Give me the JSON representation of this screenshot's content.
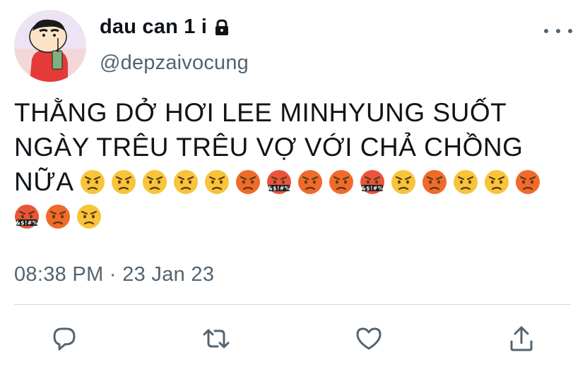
{
  "user": {
    "display_name": "dau can 1 i",
    "handle": "@depzaivocung",
    "lock_icon": "lock-icon",
    "avatar": "profile-avatar"
  },
  "tweet": {
    "text": "THẰNG DỞ HƠI LEE MINHYUNG SUỐT NGÀY TRÊU TRÊU VỢ VỚI CHẢ CHỒNG NỮA",
    "emoji_sequence": [
      "annoyed",
      "annoyed",
      "annoyed",
      "annoyed",
      "annoyed",
      "angry",
      "cursing",
      "angry",
      "angry",
      "cursing",
      "annoyed",
      "angry",
      "annoyed",
      "annoyed",
      "angry",
      "cursing",
      "angry",
      "annoyed"
    ],
    "cursing_symbols": "&$!#%"
  },
  "meta": {
    "timestamp": "08:38 PM · 23 Jan 23"
  },
  "actions": {
    "reply": "reply-icon",
    "retweet": "retweet-icon",
    "like": "heart-icon",
    "share": "share-icon"
  },
  "colors": {
    "text": "#0f1419",
    "secondary": "#536471",
    "icon": "#536471",
    "divider": "#cfd9de"
  }
}
